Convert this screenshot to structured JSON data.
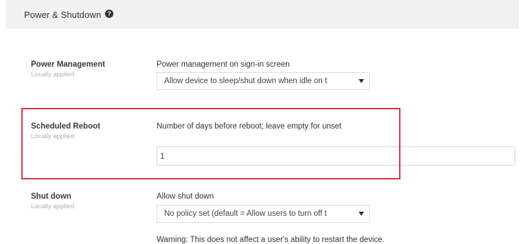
{
  "section": {
    "title": "Power & Shutdown",
    "help_icon": "help-circle-icon"
  },
  "rows": {
    "power": {
      "title": "Power Management",
      "sub": "Locally applied",
      "field_label": "Power management on sign-in screen",
      "select_value": "Allow device to sleep/shut down when idle on t"
    },
    "reboot": {
      "title": "Scheduled Reboot",
      "sub": "Locally applied",
      "field_label": "Number of days before reboot; leave empty for unset",
      "input_value": "1"
    },
    "shutdown": {
      "title": "Shut down",
      "sub": "Locally applied",
      "field_label": "Allow shut down",
      "select_value": "No policy set (default = Allow users to turn off t",
      "warning": "Warning: This does not affect a user's ability to restart the device."
    }
  },
  "colors": {
    "highlight": "#d9333a",
    "header_bg": "#f1f1f1"
  }
}
